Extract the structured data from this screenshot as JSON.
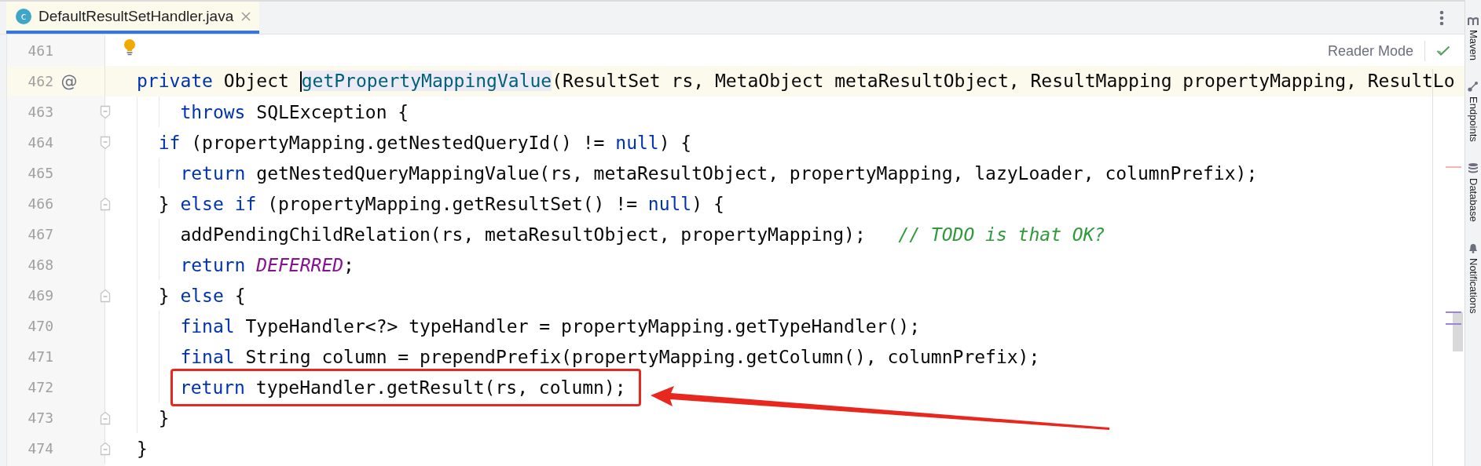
{
  "tabs": [
    {
      "icon_letter": "c",
      "label": "DefaultResultSetHandler.java",
      "selected": true
    }
  ],
  "reader_mode": {
    "label": "Reader Mode"
  },
  "lines": [
    {
      "number": "461",
      "current": false,
      "fold_start": false,
      "fold_end": false
    },
    {
      "number": "462",
      "current": true,
      "marker": "@",
      "fold_start": false,
      "fold_end": false,
      "boxed": false,
      "tokens": [
        {
          "kind": "keyword",
          "text": "private "
        },
        {
          "kind": "plain",
          "text": "Object "
        },
        {
          "kind": "caret"
        },
        {
          "kind": "declaration",
          "text": "getPropertyMappingValue"
        },
        {
          "kind": "plain",
          "text": "(ResultSet rs, MetaObject metaResultObject, ResultMapping propertyMapping, ResultLo"
        }
      ]
    },
    {
      "number": "463",
      "current": false,
      "fold_start": true,
      "fold_end": false,
      "boxed": false,
      "tokens": [
        {
          "kind": "indent"
        },
        {
          "kind": "indent"
        },
        {
          "kind": "keyword",
          "text": "throws "
        },
        {
          "kind": "plain",
          "text": "SQLException {"
        }
      ]
    },
    {
      "number": "464",
      "current": false,
      "fold_start": true,
      "fold_end": false,
      "boxed": false,
      "tokens": [
        {
          "kind": "indent"
        },
        {
          "kind": "keyword",
          "text": "if "
        },
        {
          "kind": "plain",
          "text": "(propertyMapping.getNestedQueryId() != "
        },
        {
          "kind": "keyword",
          "text": "null"
        },
        {
          "kind": "plain",
          "text": ") {"
        }
      ]
    },
    {
      "number": "465",
      "current": false,
      "fold_start": false,
      "fold_end": false,
      "boxed": false,
      "tokens": [
        {
          "kind": "indent"
        },
        {
          "kind": "indent"
        },
        {
          "kind": "keyword",
          "text": "return "
        },
        {
          "kind": "plain",
          "text": "getNestedQueryMappingValue(rs, metaResultObject, propertyMapping, lazyLoader, columnPrefix);"
        }
      ]
    },
    {
      "number": "466",
      "current": false,
      "fold_start": false,
      "fold_end": true,
      "boxed": false,
      "tokens": [
        {
          "kind": "indent"
        },
        {
          "kind": "plain",
          "text": "} "
        },
        {
          "kind": "keyword",
          "text": "else if "
        },
        {
          "kind": "plain",
          "text": "(propertyMapping.getResultSet() != "
        },
        {
          "kind": "keyword",
          "text": "null"
        },
        {
          "kind": "plain",
          "text": ") {"
        }
      ]
    },
    {
      "number": "467",
      "current": false,
      "fold_start": false,
      "fold_end": false,
      "boxed": false,
      "tokens": [
        {
          "kind": "indent"
        },
        {
          "kind": "indent"
        },
        {
          "kind": "plain",
          "text": "addPendingChildRelation(rs, metaResultObject, propertyMapping);   "
        },
        {
          "kind": "comment",
          "text": "// TODO is that OK?"
        }
      ]
    },
    {
      "number": "468",
      "current": false,
      "fold_start": false,
      "fold_end": false,
      "boxed": false,
      "tokens": [
        {
          "kind": "indent"
        },
        {
          "kind": "indent"
        },
        {
          "kind": "keyword",
          "text": "return "
        },
        {
          "kind": "constant",
          "text": "DEFERRED"
        },
        {
          "kind": "plain",
          "text": ";"
        }
      ]
    },
    {
      "number": "469",
      "current": false,
      "fold_start": false,
      "fold_end": true,
      "boxed": false,
      "tokens": [
        {
          "kind": "indent"
        },
        {
          "kind": "plain",
          "text": "} "
        },
        {
          "kind": "keyword",
          "text": "else "
        },
        {
          "kind": "plain",
          "text": "{"
        }
      ]
    },
    {
      "number": "470",
      "current": false,
      "fold_start": false,
      "fold_end": false,
      "boxed": false,
      "tokens": [
        {
          "kind": "indent"
        },
        {
          "kind": "indent"
        },
        {
          "kind": "keyword",
          "text": "final "
        },
        {
          "kind": "plain",
          "text": "TypeHandler<?> typeHandler = propertyMapping.getTypeHandler();"
        }
      ]
    },
    {
      "number": "471",
      "current": false,
      "fold_start": false,
      "fold_end": false,
      "boxed": false,
      "tokens": [
        {
          "kind": "indent"
        },
        {
          "kind": "indent"
        },
        {
          "kind": "keyword",
          "text": "final "
        },
        {
          "kind": "plain",
          "text": "String column = prependPrefix(propertyMapping.getColumn(), columnPrefix);"
        }
      ]
    },
    {
      "number": "472",
      "current": false,
      "fold_start": false,
      "fold_end": false,
      "boxed": true,
      "tokens": [
        {
          "kind": "indent"
        },
        {
          "kind": "indent"
        },
        {
          "kind": "keyword",
          "text": "return "
        },
        {
          "kind": "plain",
          "text": "typeHandler.getResult(rs, column);"
        }
      ]
    },
    {
      "number": "473",
      "current": false,
      "fold_start": false,
      "fold_end": true,
      "boxed": false,
      "tokens": [
        {
          "kind": "indent"
        },
        {
          "kind": "plain",
          "text": "}"
        }
      ]
    },
    {
      "number": "474",
      "current": false,
      "fold_start": false,
      "fold_end": true,
      "boxed": false,
      "tokens": [
        {
          "kind": "plain",
          "text": "}"
        }
      ]
    }
  ],
  "tool_windows": [
    {
      "kind": "maven",
      "label": "Maven"
    },
    {
      "kind": "endpoints",
      "label": "Endpoints"
    },
    {
      "kind": "database",
      "label": "Database"
    },
    {
      "kind": "notifications",
      "label": "Notifications"
    }
  ]
}
